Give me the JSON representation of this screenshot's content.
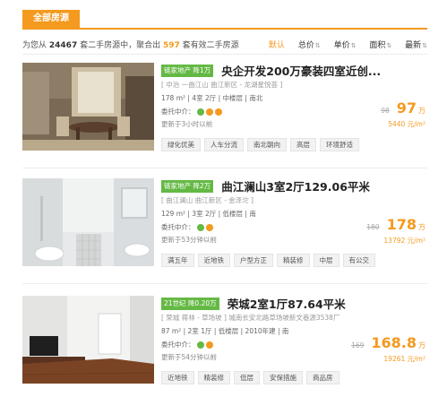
{
  "tab_label": "全部房源",
  "summary": {
    "before": "为您从",
    "total": "24467",
    "middle": "套二手房源中，聚合出",
    "count": "597",
    "after": "套有效二手房源"
  },
  "sort_options": [
    "默认",
    "总价",
    "单价",
    "面积",
    "最新"
  ],
  "listings": [
    {
      "badge_org": "链家地产",
      "badge_drop": "降1万",
      "title": "央企开发200万豪装四室近创...",
      "location": "[ 中治 一曲江山  曲江新区 - 龙湖星悦荟 ]",
      "attrs": "178 m² | 4室 2厅 | 中楼层 | 南北",
      "agent_label": "委托中介：",
      "updated": "更新于3小时以前",
      "tags": [
        "绿化优美",
        "人车分流",
        "南北朝向",
        "高层",
        "环境舒适"
      ],
      "old_price": "98",
      "price": "97",
      "price_unit": "万",
      "unit_price": "5440 元/m²"
    },
    {
      "badge_org": "链家地产",
      "badge_drop": "降2万",
      "title": "曲江澜山3室2厅129.06平米",
      "location": "[ 曲江澜山  曲江新区 - 金泽沱 ]",
      "attrs": "129 m² | 3室 2厅 | 低楼层 | 南",
      "agent_label": "委托中介：",
      "updated": "更新于53分钟以前",
      "tags": [
        "满五年",
        "近地铁",
        "户型方正",
        "精装修",
        "中层",
        "有公交"
      ],
      "old_price": "180",
      "price": "178",
      "price_unit": "万",
      "unit_price": "13792 元/m²"
    },
    {
      "badge_org": "21世纪",
      "badge_drop": "降0.20万",
      "title": "荣城2室1厅87.64平米",
      "location": "[ 荣城  蒋林 - 草场坡 ] 城南长安北路草场坡新文巷源3538厂",
      "attrs": "87 m² | 2室 1厅 | 低楼层 | 2010年建 | 南",
      "agent_label": "委托中介：",
      "updated": "更新于54分钟以前",
      "tags": [
        "近地铁",
        "精装修",
        "低层",
        "安保措施",
        "商品房"
      ],
      "old_price": "169",
      "price": "168.8",
      "price_unit": "万",
      "unit_price": "19261 元/m²"
    }
  ]
}
